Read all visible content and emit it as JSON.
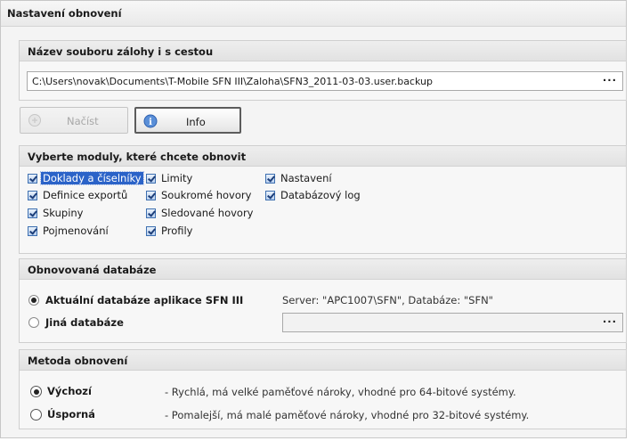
{
  "panel": {
    "title": "Nastavení obnovení"
  },
  "file_group": {
    "title": "Název souboru zálohy i s cestou",
    "path": "C:\\Users\\novak\\Documents\\T-Mobile SFN III\\Zaloha\\SFN3_2011-03-03.user.backup",
    "browse_label": "···"
  },
  "buttons": {
    "load_label": "Načíst",
    "info_label": "Info"
  },
  "modules_group": {
    "title": "Vyberte moduly, které chcete obnovit",
    "modules": [
      {
        "label": "Doklady a číselníky",
        "checked": true
      },
      {
        "label": "Definice exportů",
        "checked": true
      },
      {
        "label": "Skupiny",
        "checked": true
      },
      {
        "label": "Pojmenování",
        "checked": true
      },
      {
        "label": "Limity",
        "checked": true
      },
      {
        "label": "Soukromé hovory",
        "checked": true
      },
      {
        "label": "Sledované hovory",
        "checked": true
      },
      {
        "label": "Profily",
        "checked": true
      },
      {
        "label": "Nastavení",
        "checked": true
      },
      {
        "label": "Databázový log",
        "checked": true
      }
    ]
  },
  "database_group": {
    "title": "Obnovovaná databáze",
    "current_label": "Aktuální databáze aplikace SFN III",
    "current_info": "Server: \"APC1007\\SFN\", Databáze: \"SFN\"",
    "other_label": "Jiná databáze",
    "other_value": "",
    "browse_label": "···",
    "selected": "current"
  },
  "method_group": {
    "title": "Metoda obnovení",
    "default_label": "Výchozí",
    "default_desc": "- Rychlá, má velké paměťové nároky, vhodné pro 64-bitové systémy.",
    "saving_label": "Úsporná",
    "saving_desc": "- Pomalejší, má malé paměťové nároky, vhodné pro 32-bitové systémy.",
    "selected": "default"
  }
}
